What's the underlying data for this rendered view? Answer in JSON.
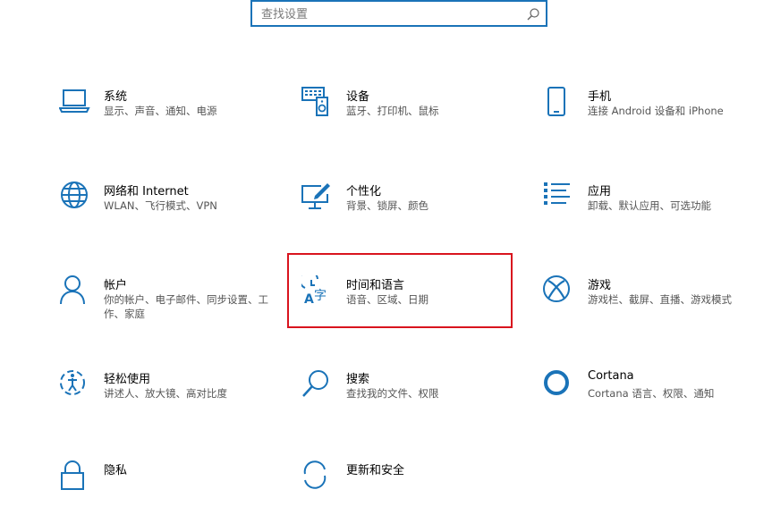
{
  "search": {
    "placeholder": "查找设置"
  },
  "tiles": [
    {
      "title": "系统",
      "desc": "显示、声音、通知、电源",
      "icon": "laptop-icon"
    },
    {
      "title": "设备",
      "desc": "蓝牙、打印机、鼠标",
      "icon": "keyboard-speaker-icon"
    },
    {
      "title": "手机",
      "desc": "连接 Android 设备和 iPhone",
      "icon": "phone-icon"
    },
    {
      "title": "网络和 Internet",
      "desc": "WLAN、飞行模式、VPN",
      "icon": "globe-icon"
    },
    {
      "title": "个性化",
      "desc": "背景、锁屏、颜色",
      "icon": "paint-monitor-icon"
    },
    {
      "title": "应用",
      "desc": "卸载、默认应用、可选功能",
      "icon": "apps-list-icon"
    },
    {
      "title": "帐户",
      "desc": "你的帐户、电子邮件、同步设置、工作、家庭",
      "icon": "person-icon"
    },
    {
      "title": "时间和语言",
      "desc": "语音、区域、日期",
      "icon": "time-language-icon"
    },
    {
      "title": "游戏",
      "desc": "游戏栏、截屏、直播、游戏模式",
      "icon": "xbox-icon"
    },
    {
      "title": "轻松使用",
      "desc": "讲述人、放大镜、高对比度",
      "icon": "ease-of-access-icon"
    },
    {
      "title": "搜索",
      "desc": "查找我的文件、权限",
      "icon": "search-magnifier-icon"
    },
    {
      "title": "Cortana",
      "desc": "Cortana 语言、权限、通知",
      "icon": "cortana-ring-icon"
    },
    {
      "title": "隐私",
      "desc": "",
      "icon": "lock-icon"
    },
    {
      "title": "更新和安全",
      "desc": "",
      "icon": "sync-icon"
    }
  ],
  "colors": {
    "accent": "#1a73b8",
    "highlight": "#d9141e"
  }
}
